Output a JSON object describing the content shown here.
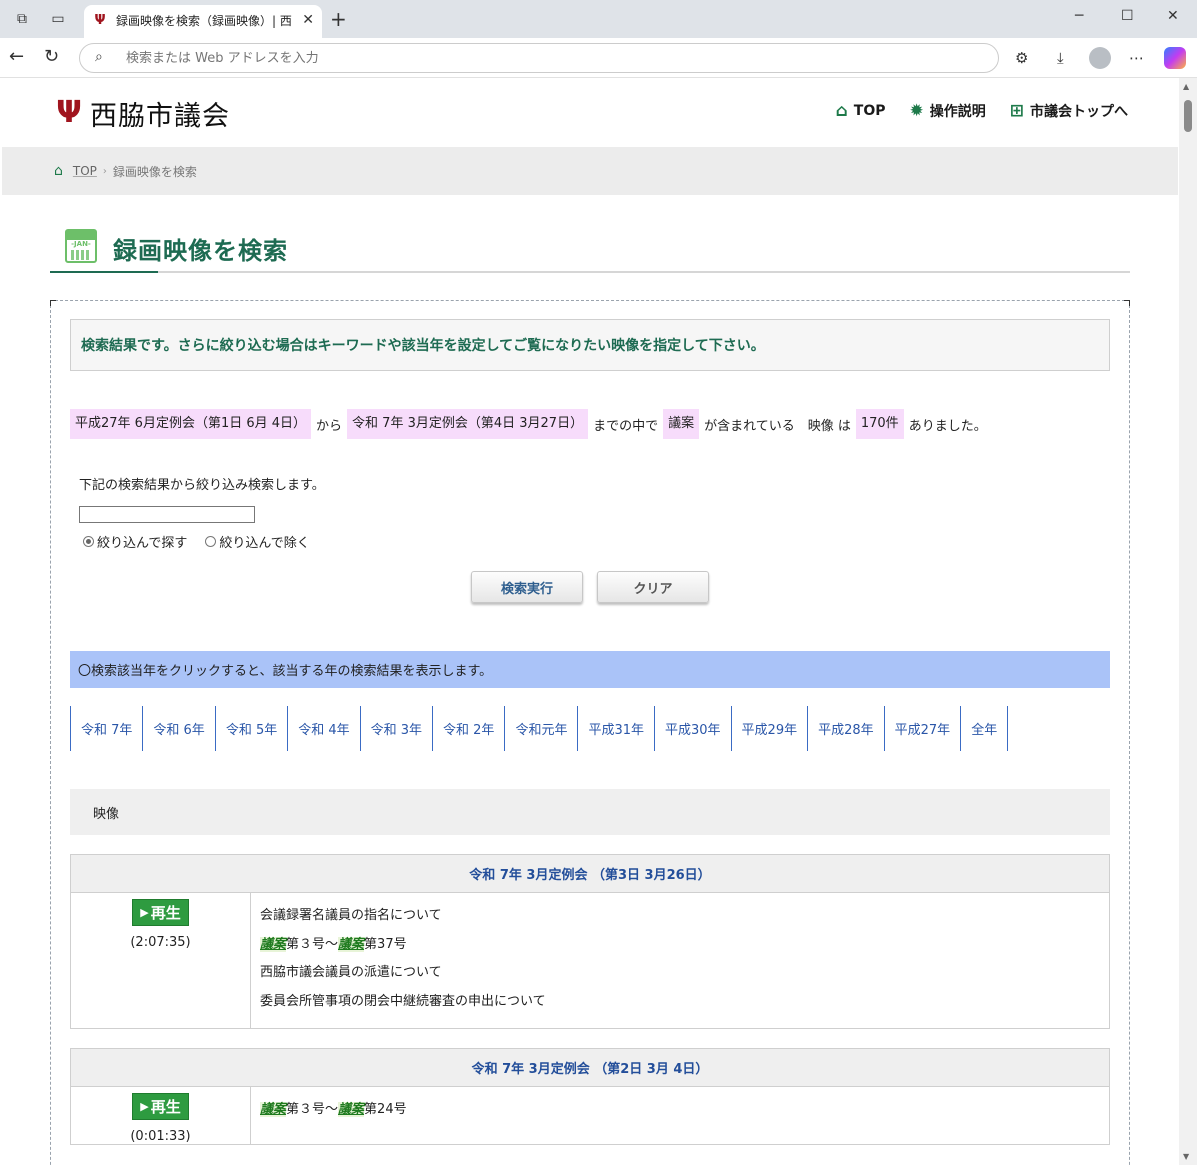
{
  "browser": {
    "tab_title": "録画映像を検索（録画映像）| 西脇市議会",
    "address_placeholder": "検索または Web アドレスを入力"
  },
  "site": {
    "name": "西脇市議会",
    "nav": [
      {
        "label": "TOP",
        "icon": "home-icon"
      },
      {
        "label": "操作説明",
        "icon": "gear-icon"
      },
      {
        "label": "市議会トップへ",
        "icon": "sitemap-icon"
      }
    ]
  },
  "breadcrumb": {
    "home": "TOP",
    "current": "録画映像を検索"
  },
  "page": {
    "title": "録画映像を検索",
    "calendar_label": "-JAN-"
  },
  "notice": "検索結果です。さらに絞り込む場合はキーワードや該当年を設定してご覧になりたい映像を指定して下さい。",
  "summary": {
    "from": "平成27年 6月定例会（第1日 6月 4日）",
    "t1": "から",
    "to": "令和 7年 3月定例会（第4日 3月27日）",
    "t2": "までの中で",
    "keyword": "議案",
    "t3": "が含まれている　映像 は",
    "count": "170件",
    "t4": "ありました。"
  },
  "refine": {
    "label": "下記の検索結果から絞り込み検索します。",
    "input_value": "",
    "radio_include": "絞り込んで探す",
    "radio_exclude": "絞り込んで除く",
    "search_button": "検索実行",
    "clear_button": "クリア"
  },
  "year_info": "〇検索該当年をクリックすると、該当する年の検索結果を表示します。",
  "years": [
    "令和 7年",
    "令和 6年",
    "令和 5年",
    "令和 4年",
    "令和 3年",
    "令和 2年",
    "令和元年",
    "平成31年",
    "平成30年",
    "平成29年",
    "平成28年",
    "平成27年",
    "全年"
  ],
  "video_header": "映像",
  "sessions": [
    {
      "title": "令和 7年 3月定例会 （第3日 3月26日）",
      "play": "再生",
      "duration": "(2:07:35)",
      "items": [
        {
          "plain": "会議録署名議員の指名について"
        },
        {
          "k1": "議案",
          "m1": "第３号～",
          "k2": "議案",
          "m2": "第37号"
        },
        {
          "plain": "西脇市議会議員の派遣について"
        },
        {
          "plain": "委員会所管事項の閉会中継続審査の申出について"
        }
      ]
    },
    {
      "title": "令和 7年 3月定例会 （第2日 3月 4日）",
      "play": "再生",
      "duration": "(0:01:33)",
      "items": [
        {
          "k1": "議案",
          "m1": "第３号～",
          "k2": "議案",
          "m2": "第24号"
        }
      ]
    }
  ]
}
